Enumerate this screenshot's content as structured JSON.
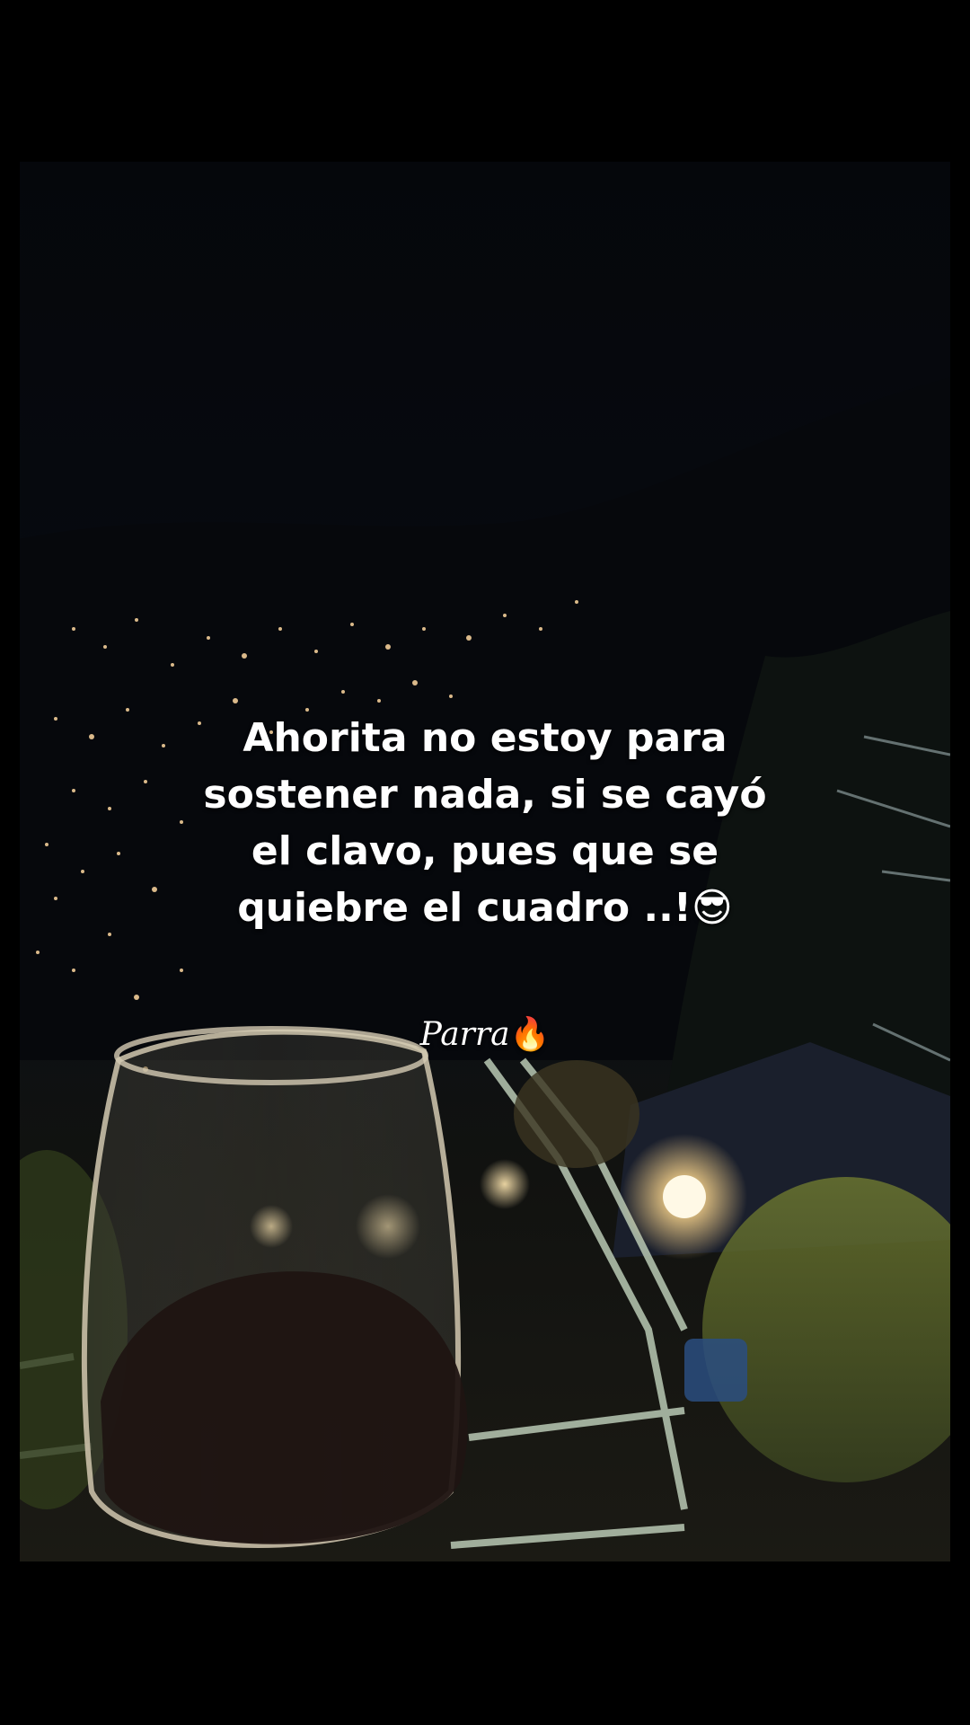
{
  "overlay": {
    "caption_lines": [
      "Ahorita no estoy para",
      "sostener nada, si se cayó",
      "el clavo, pues que se",
      "quiebre el cuadro ..!😎"
    ],
    "signature": "Parra",
    "signature_emoji": "🔥"
  },
  "colors": {
    "background": "#000000",
    "caption_text": "#ffffff"
  }
}
